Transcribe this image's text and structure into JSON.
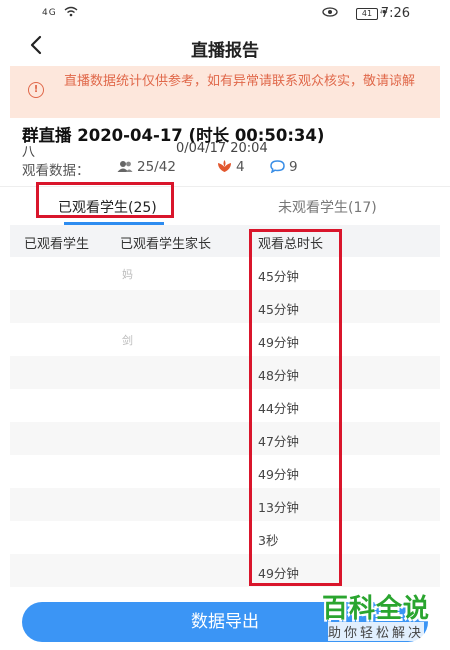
{
  "status_bar": {
    "signal": "4G",
    "battery": "41",
    "time": "7:26"
  },
  "nav": {
    "title": "直播报告"
  },
  "notice": {
    "text": "直播数据统计仅供参考，如有异常请联系观众核实，敬请谅解"
  },
  "room": {
    "title": "群直播 2020-04-17 (时长 00:50:34)",
    "subtitle_prefix": "八",
    "datetime": "0/04/17 20:04"
  },
  "stats": {
    "label": "观看数据：",
    "viewers": "25/42",
    "flowers": "4",
    "comments": "9"
  },
  "tabs": [
    {
      "label": "已观看学生(25)",
      "active": true
    },
    {
      "label": "未观看学生(17)",
      "active": false
    }
  ],
  "table": {
    "columns": [
      "已观看学生",
      "已观看学生家长",
      "观看总时长"
    ],
    "rows": [
      {
        "student": "",
        "parent": "妈",
        "duration": "45分钟"
      },
      {
        "student": "",
        "parent": "",
        "duration": "45分钟"
      },
      {
        "student": "",
        "parent": "剑",
        "duration": "49分钟"
      },
      {
        "student": "",
        "parent": "",
        "duration": "48分钟"
      },
      {
        "student": "",
        "parent": "",
        "duration": "44分钟"
      },
      {
        "student": "",
        "parent": "",
        "duration": "47分钟"
      },
      {
        "student": "",
        "parent": "",
        "duration": "49分钟"
      },
      {
        "student": "",
        "parent": "",
        "duration": "13分钟"
      },
      {
        "student": "",
        "parent": "",
        "duration": "3秒"
      },
      {
        "student": "",
        "parent": "",
        "duration": "49分钟"
      }
    ]
  },
  "export_button": {
    "label": "数据导出"
  },
  "watermark": {
    "main": "百科全说",
    "sub": "助你轻松解决"
  },
  "colors": {
    "accent": "#3b95f5",
    "tab_underline": "#2d8cf0",
    "notice_bg": "#fde7dc",
    "notice_text": "#e0684a",
    "highlight_box": "#d9152b",
    "watermark_green": "#2aa52f"
  },
  "icons": {
    "back": "chevron-left-icon",
    "notice": "alert-circle-icon",
    "viewers": "people-icon",
    "flowers": "flower-icon",
    "comments": "comment-bubble-icon"
  }
}
